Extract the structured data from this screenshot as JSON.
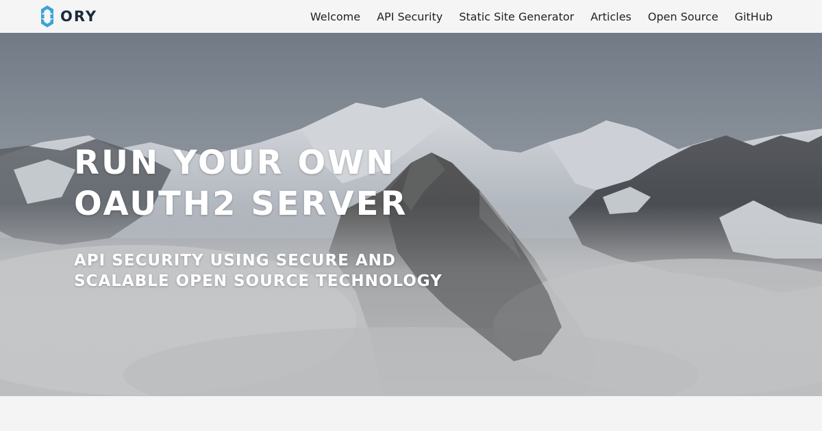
{
  "brand": {
    "name": "ORY",
    "colors": {
      "logo_accent": "#3aa3d8",
      "logo_text": "#1a2a3a"
    }
  },
  "nav": {
    "items": [
      {
        "label": "Welcome"
      },
      {
        "label": "API Security"
      },
      {
        "label": "Static Site Generator"
      },
      {
        "label": "Articles"
      },
      {
        "label": "Open Source"
      },
      {
        "label": "GitHub"
      }
    ]
  },
  "hero": {
    "title_line1": "RUN YOUR OWN",
    "title_line2": "OAUTH2 SERVER",
    "subtitle_line1": "API SECURITY USING SECURE AND",
    "subtitle_line2": "SCALABLE OPEN SOURCE TECHNOLOGY",
    "background_image": "snowy-mountains-above-clouds"
  }
}
